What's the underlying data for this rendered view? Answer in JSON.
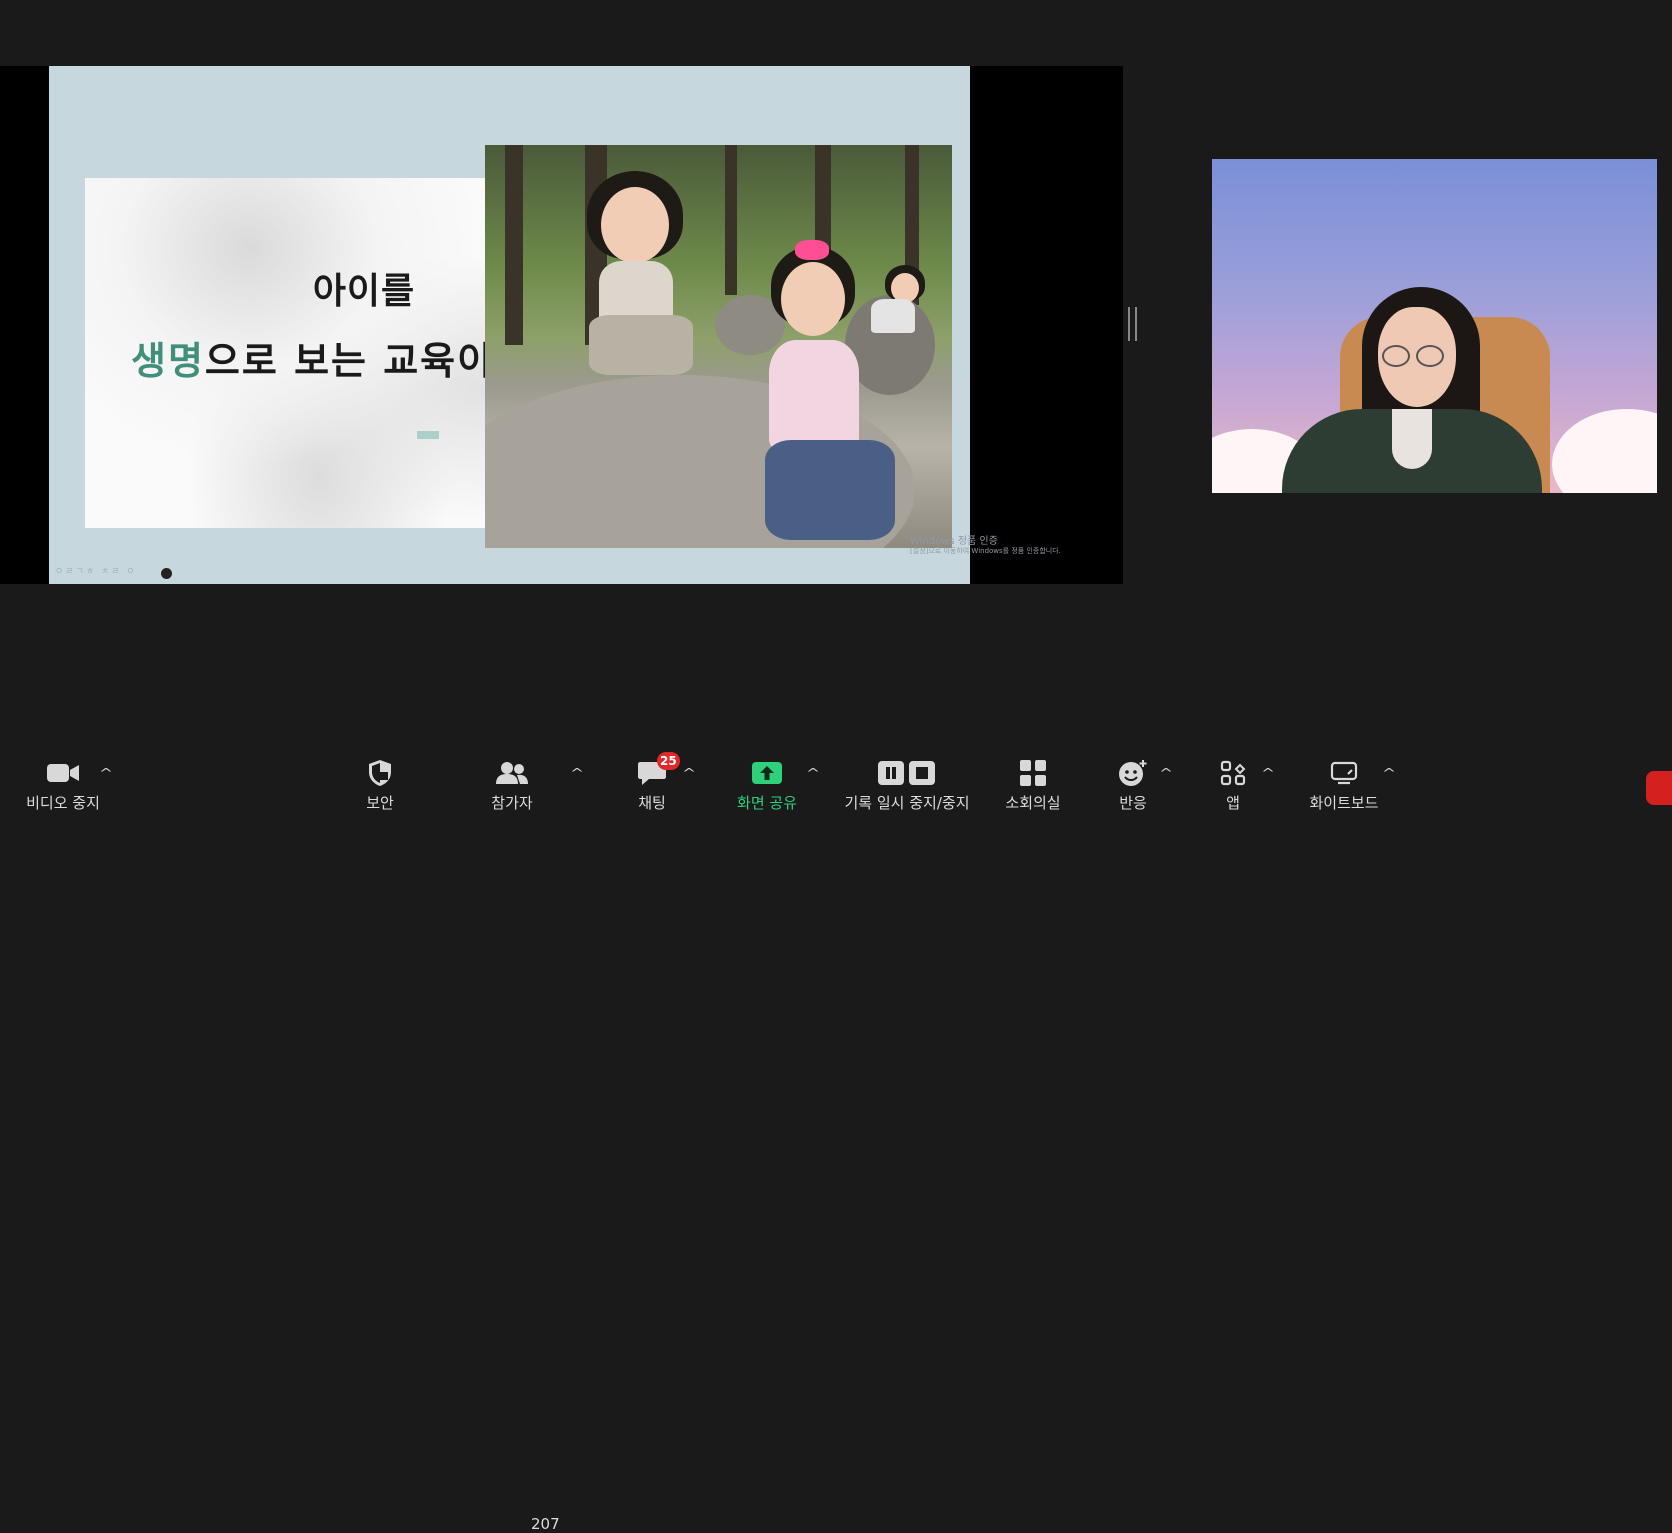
{
  "slide": {
    "line1": "아이를",
    "line2_accent": "생명",
    "line2_rest": "으로 보는 교육이다",
    "watermark_title": "Windows 정품 인증",
    "watermark_sub": "[설정]으로 이동하여 Windows를 정품 인증합니다.",
    "footer": "ㅇㄹㄱㅎ ㅊㄹ ㅇ"
  },
  "toolbar": {
    "video": {
      "label": "비디오 중지",
      "icon": "video-camera-icon"
    },
    "security": {
      "label": "보안",
      "icon": "shield-icon"
    },
    "participants": {
      "label": "참가자",
      "icon": "people-icon",
      "count": "207"
    },
    "chat": {
      "label": "채팅",
      "icon": "chat-bubble-icon",
      "badge": "25"
    },
    "share": {
      "label": "화면 공유",
      "icon": "share-screen-icon"
    },
    "record": {
      "label": "기록 일시 중지/중지",
      "icon": "pause-stop-icon"
    },
    "breakout": {
      "label": "소회의실",
      "icon": "grid-icon"
    },
    "reactions": {
      "label": "반응",
      "icon": "emoji-icon"
    },
    "apps": {
      "label": "앱",
      "icon": "apps-icon"
    },
    "whiteboard": {
      "label": "화이트보드",
      "icon": "whiteboard-icon"
    }
  },
  "colors": {
    "accent_green": "#2fd07a",
    "slide_accent": "#3f8f7b",
    "badge_red": "#e02828",
    "background": "#1a1a1a"
  }
}
